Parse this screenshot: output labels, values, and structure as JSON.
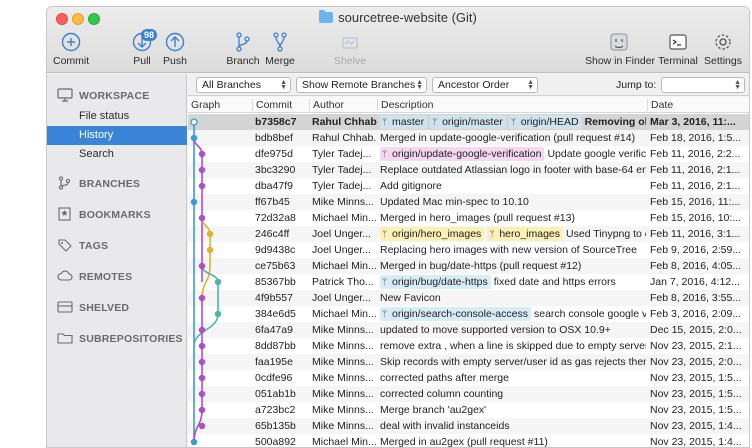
{
  "window": {
    "title": "sourcetree-website (Git)"
  },
  "toolbar": {
    "commit": "Commit",
    "pull": "Pull",
    "pull_badge": "98",
    "push": "Push",
    "branch": "Branch",
    "merge": "Merge",
    "shelve": "Shelve",
    "show_in_finder": "Show in Finder",
    "terminal": "Terminal",
    "settings": "Settings"
  },
  "sidebar": {
    "workspace": "WORKSPACE",
    "file_status": "File status",
    "history": "History",
    "search": "Search",
    "branches": "BRANCHES",
    "bookmarks": "BOOKMARKS",
    "tags": "TAGS",
    "remotes": "REMOTES",
    "shelved": "SHELVED",
    "subrepositories": "SUBREPOSITORIES"
  },
  "filters": {
    "branches": "All Branches",
    "remote": "Show Remote Branches",
    "order": "Ancestor Order",
    "jump_to": "Jump to:"
  },
  "columns": {
    "graph": "Graph",
    "commit": "Commit",
    "author": "Author",
    "description": "Description",
    "date": "Date"
  },
  "colors": {
    "accent": "#3a85d8",
    "tag_blue": "#d6ecf7",
    "tag_yellow": "#fbf0b5",
    "tag_pink": "#f6d7f1"
  },
  "commits": [
    {
      "hash": "b7358c7",
      "author": "Rahul Chhab...",
      "tags": [
        {
          "label": "master",
          "style": "blue"
        },
        {
          "label": "origin/master",
          "style": "blue"
        },
        {
          "label": "origin/HEAD",
          "style": "blue"
        }
      ],
      "desc": "Removing ol...",
      "date": "Mar 3, 2016, 11:..."
    },
    {
      "hash": "bdb8bef",
      "author": "Rahul Chhab...",
      "tags": [],
      "desc": "Merged in update-google-verification (pull request #14)",
      "date": "Feb 18, 2016, 1:5..."
    },
    {
      "hash": "dfe975d",
      "author": "Tyler Tadej...",
      "tags": [
        {
          "label": "origin/update-google-verification",
          "style": "pink"
        }
      ],
      "desc": "Update google verificati...",
      "date": "Feb 11, 2016, 2:2..."
    },
    {
      "hash": "3bc3290",
      "author": "Tyler Tadej...",
      "tags": [],
      "desc": "Replace outdated Atlassian logo in footer with base-64 en...",
      "date": "Feb 11, 2016, 2:1..."
    },
    {
      "hash": "dba47f9",
      "author": "Tyler Tadej...",
      "tags": [],
      "desc": "Add gitignore",
      "date": "Feb 11, 2016, 2:1..."
    },
    {
      "hash": "ff67b45",
      "author": "Mike Minns...",
      "tags": [],
      "desc": "Updated Mac min-spec to 10.10",
      "date": "Feb 15, 2016, 11:..."
    },
    {
      "hash": "72d32a8",
      "author": "Michael Min...",
      "tags": [],
      "desc": "Merged in hero_images (pull request #13)",
      "date": "Feb 15, 2016, 10:..."
    },
    {
      "hash": "246c4ff",
      "author": "Joel Unger...",
      "tags": [
        {
          "label": "origin/hero_images",
          "style": "yellow"
        },
        {
          "label": "hero_images",
          "style": "yellow"
        }
      ],
      "desc": "Used Tinypng to c...",
      "date": "Feb 11, 2016, 3:1..."
    },
    {
      "hash": "9d9438c",
      "author": "Joel Unger...",
      "tags": [],
      "desc": "Replacing hero images with new version of SourceTree",
      "date": "Feb 9, 2016, 2:59..."
    },
    {
      "hash": "ce75b63",
      "author": "Michael Min...",
      "tags": [],
      "desc": "Merged in bug/date-https (pull request #12)",
      "date": "Feb 8, 2016, 4:05..."
    },
    {
      "hash": "85367bb",
      "author": "Patrick Tho...",
      "tags": [
        {
          "label": "origin/bug/date-https",
          "style": "blue"
        }
      ],
      "desc": "fixed date and https errors",
      "date": "Jan 7, 2016, 4:12..."
    },
    {
      "hash": "4f9b557",
      "author": "Joel Unger...",
      "tags": [],
      "desc": "New Favicon",
      "date": "Feb 8, 2016, 3:55..."
    },
    {
      "hash": "384e6d5",
      "author": "Michael Min...",
      "tags": [
        {
          "label": "origin/search-console-access",
          "style": "blue"
        }
      ],
      "desc": "search console google ver...",
      "date": "Feb 3, 2016, 2:09..."
    },
    {
      "hash": "6fa47a9",
      "author": "Mike Minns...",
      "tags": [],
      "desc": "updated to move supported version to OSX 10.9+",
      "date": "Dec 15, 2015, 2:0..."
    },
    {
      "hash": "8dd87bb",
      "author": "Mike Minns...",
      "tags": [],
      "desc": "remove extra , when a line is skipped due to empty server",
      "date": "Nov 23, 2015, 2:1..."
    },
    {
      "hash": "faa195e",
      "author": "Mike Minns...",
      "tags": [],
      "desc": "Skip records with empty server/user id as gas rejects them",
      "date": "Nov 23, 2015, 2:0..."
    },
    {
      "hash": "0cdfe96",
      "author": "Mike Minns...",
      "tags": [],
      "desc": "corrected paths after merge",
      "date": "Nov 23, 2015, 1:5..."
    },
    {
      "hash": "051ab1b",
      "author": "Mike Minns...",
      "tags": [],
      "desc": " corrected column counting",
      "date": "Nov 23, 2015, 1:5..."
    },
    {
      "hash": "a723bc2",
      "author": "Mike Minns...",
      "tags": [],
      "desc": "Merge branch 'au2gex'",
      "date": "Nov 23, 2015, 1:5..."
    },
    {
      "hash": "65b135b",
      "author": "Mike Minns...",
      "tags": [],
      "desc": "deal with invalid instanceids",
      "date": "Nov 23, 2015, 1:4..."
    },
    {
      "hash": "500a892",
      "author": "Michael Min...",
      "tags": [],
      "desc": "Merged in au2gex (pull request #11)",
      "date": "Nov 23, 2015, 1:4..."
    }
  ]
}
